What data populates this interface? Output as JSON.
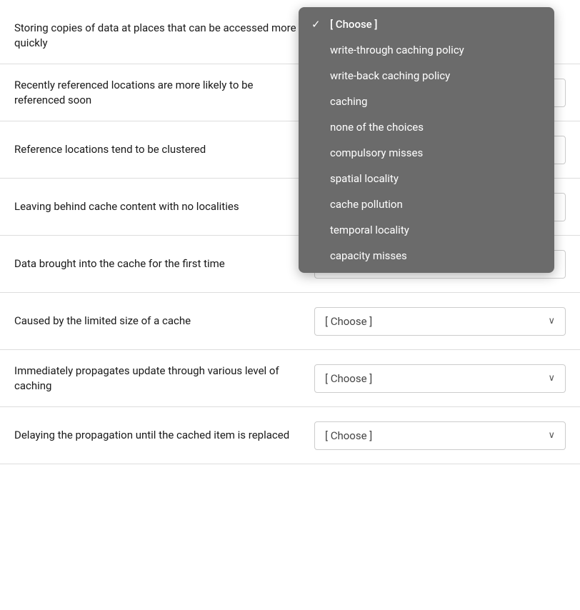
{
  "rows": [
    {
      "id": "row-1",
      "label": "Storing copies of data at places that can be accessed more quickly",
      "selectedValue": "[ Choose ]",
      "hasDropdown": true
    },
    {
      "id": "row-2",
      "label": "Recently referenced locations are more likely to be referenced soon",
      "selectedValue": "[ Choose ]",
      "hasDropdown": false
    },
    {
      "id": "row-3",
      "label": "Reference locations tend to be clustered",
      "selectedValue": "[ Choose ]",
      "hasDropdown": false
    },
    {
      "id": "row-4",
      "label": "Leaving behind cache content with no localities",
      "selectedValue": "[ Choose ]",
      "hasDropdown": false
    },
    {
      "id": "row-5",
      "label": "Data brought into the cache for the first time",
      "selectedValue": "[ Choose ]",
      "hasDropdown": false
    },
    {
      "id": "row-6",
      "label": "Caused by the limited size of a cache",
      "selectedValue": "[ Choose ]",
      "hasDropdown": false
    },
    {
      "id": "row-7",
      "label": "Immediately propagates update through various level of caching",
      "selectedValue": "[ Choose ]",
      "hasDropdown": false
    },
    {
      "id": "row-8",
      "label": "Delaying the propagation until the cached item is replaced",
      "selectedValue": "[ Choose ]",
      "hasDropdown": false
    }
  ],
  "dropdown": {
    "items": [
      {
        "label": "[ Choose ]",
        "selected": true
      },
      {
        "label": "write-through caching policy",
        "selected": false
      },
      {
        "label": "write-back caching policy",
        "selected": false
      },
      {
        "label": "caching",
        "selected": false
      },
      {
        "label": "none of the choices",
        "selected": false
      },
      {
        "label": "compulsory misses",
        "selected": false
      },
      {
        "label": "spatial locality",
        "selected": false
      },
      {
        "label": "cache pollution",
        "selected": false
      },
      {
        "label": "temporal locality",
        "selected": false
      },
      {
        "label": "capacity misses",
        "selected": false
      }
    ]
  }
}
